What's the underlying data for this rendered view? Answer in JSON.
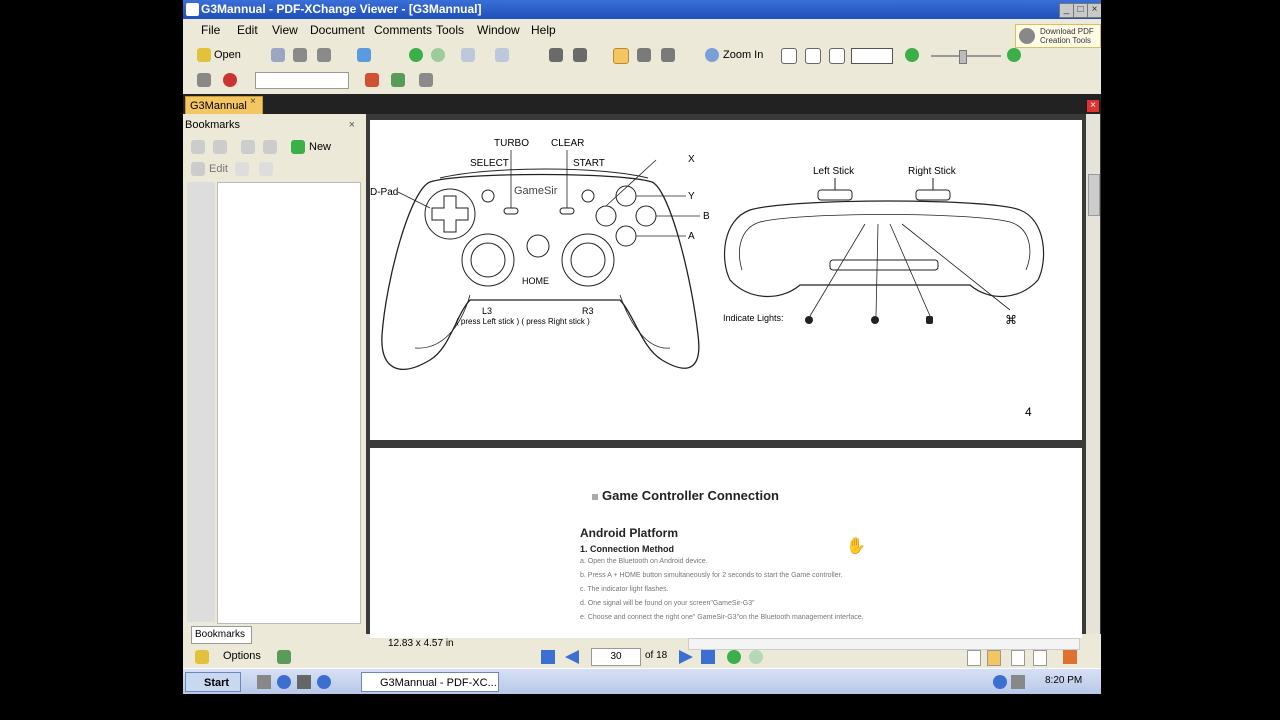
{
  "window": {
    "title": "G3Mannual - PDF-XChange Viewer - [G3Mannual]"
  },
  "menu": [
    "File",
    "Edit",
    "View",
    "Document",
    "Comments",
    "Tools",
    "Window",
    "Help"
  ],
  "download_button": "Download PDF Creation Tools",
  "toolbar": {
    "open_label": "Open",
    "zoom_label": "Zoom In"
  },
  "tab": {
    "label": "G3Mannual"
  },
  "bookmarks": {
    "title": "Bookmarks",
    "new_label": "New",
    "edit_label": "Edit",
    "tab_label": "Bookmarks"
  },
  "page4": {
    "labels": {
      "turbo": "TURBO",
      "clear": "CLEAR",
      "select": "SELECT",
      "start": "START",
      "dpad": "D-Pad",
      "brand": "GameSir",
      "x": "X",
      "y": "Y",
      "b": "B",
      "a": "A",
      "home": "HOME",
      "l3": "L3",
      "r3": "R3",
      "press": "( press Left stick )  ( press Right stick )",
      "left_stick": "Left Stick",
      "right_stick": "Right Stick",
      "indicate": "Indicate Lights:"
    },
    "page_number": "4"
  },
  "page5": {
    "heading": "Game Controller Connection",
    "platform": "Android Platform",
    "subheading": "1. Connection Method",
    "steps": [
      "a. Open the Bluetooth on Android device.",
      "b. Press A + HOME button simultaneously for 2 seconds to start the Game controller.",
      "c. The     indicator light flashes.",
      "d. One signal will be found on your screen\"GameSir-G3\"",
      "e. Choose and connect the right one\" GameSir-G3\"on the Bluetooth management interface."
    ]
  },
  "status": {
    "dimensions": "12.83 x 4.57 in"
  },
  "nav": {
    "options_label": "Options",
    "page_current": "30",
    "page_of": "of 18"
  },
  "taskbar": {
    "start_label": "Start",
    "task_label": "G3Mannual - PDF-XC...",
    "clock": "8:20 PM"
  }
}
